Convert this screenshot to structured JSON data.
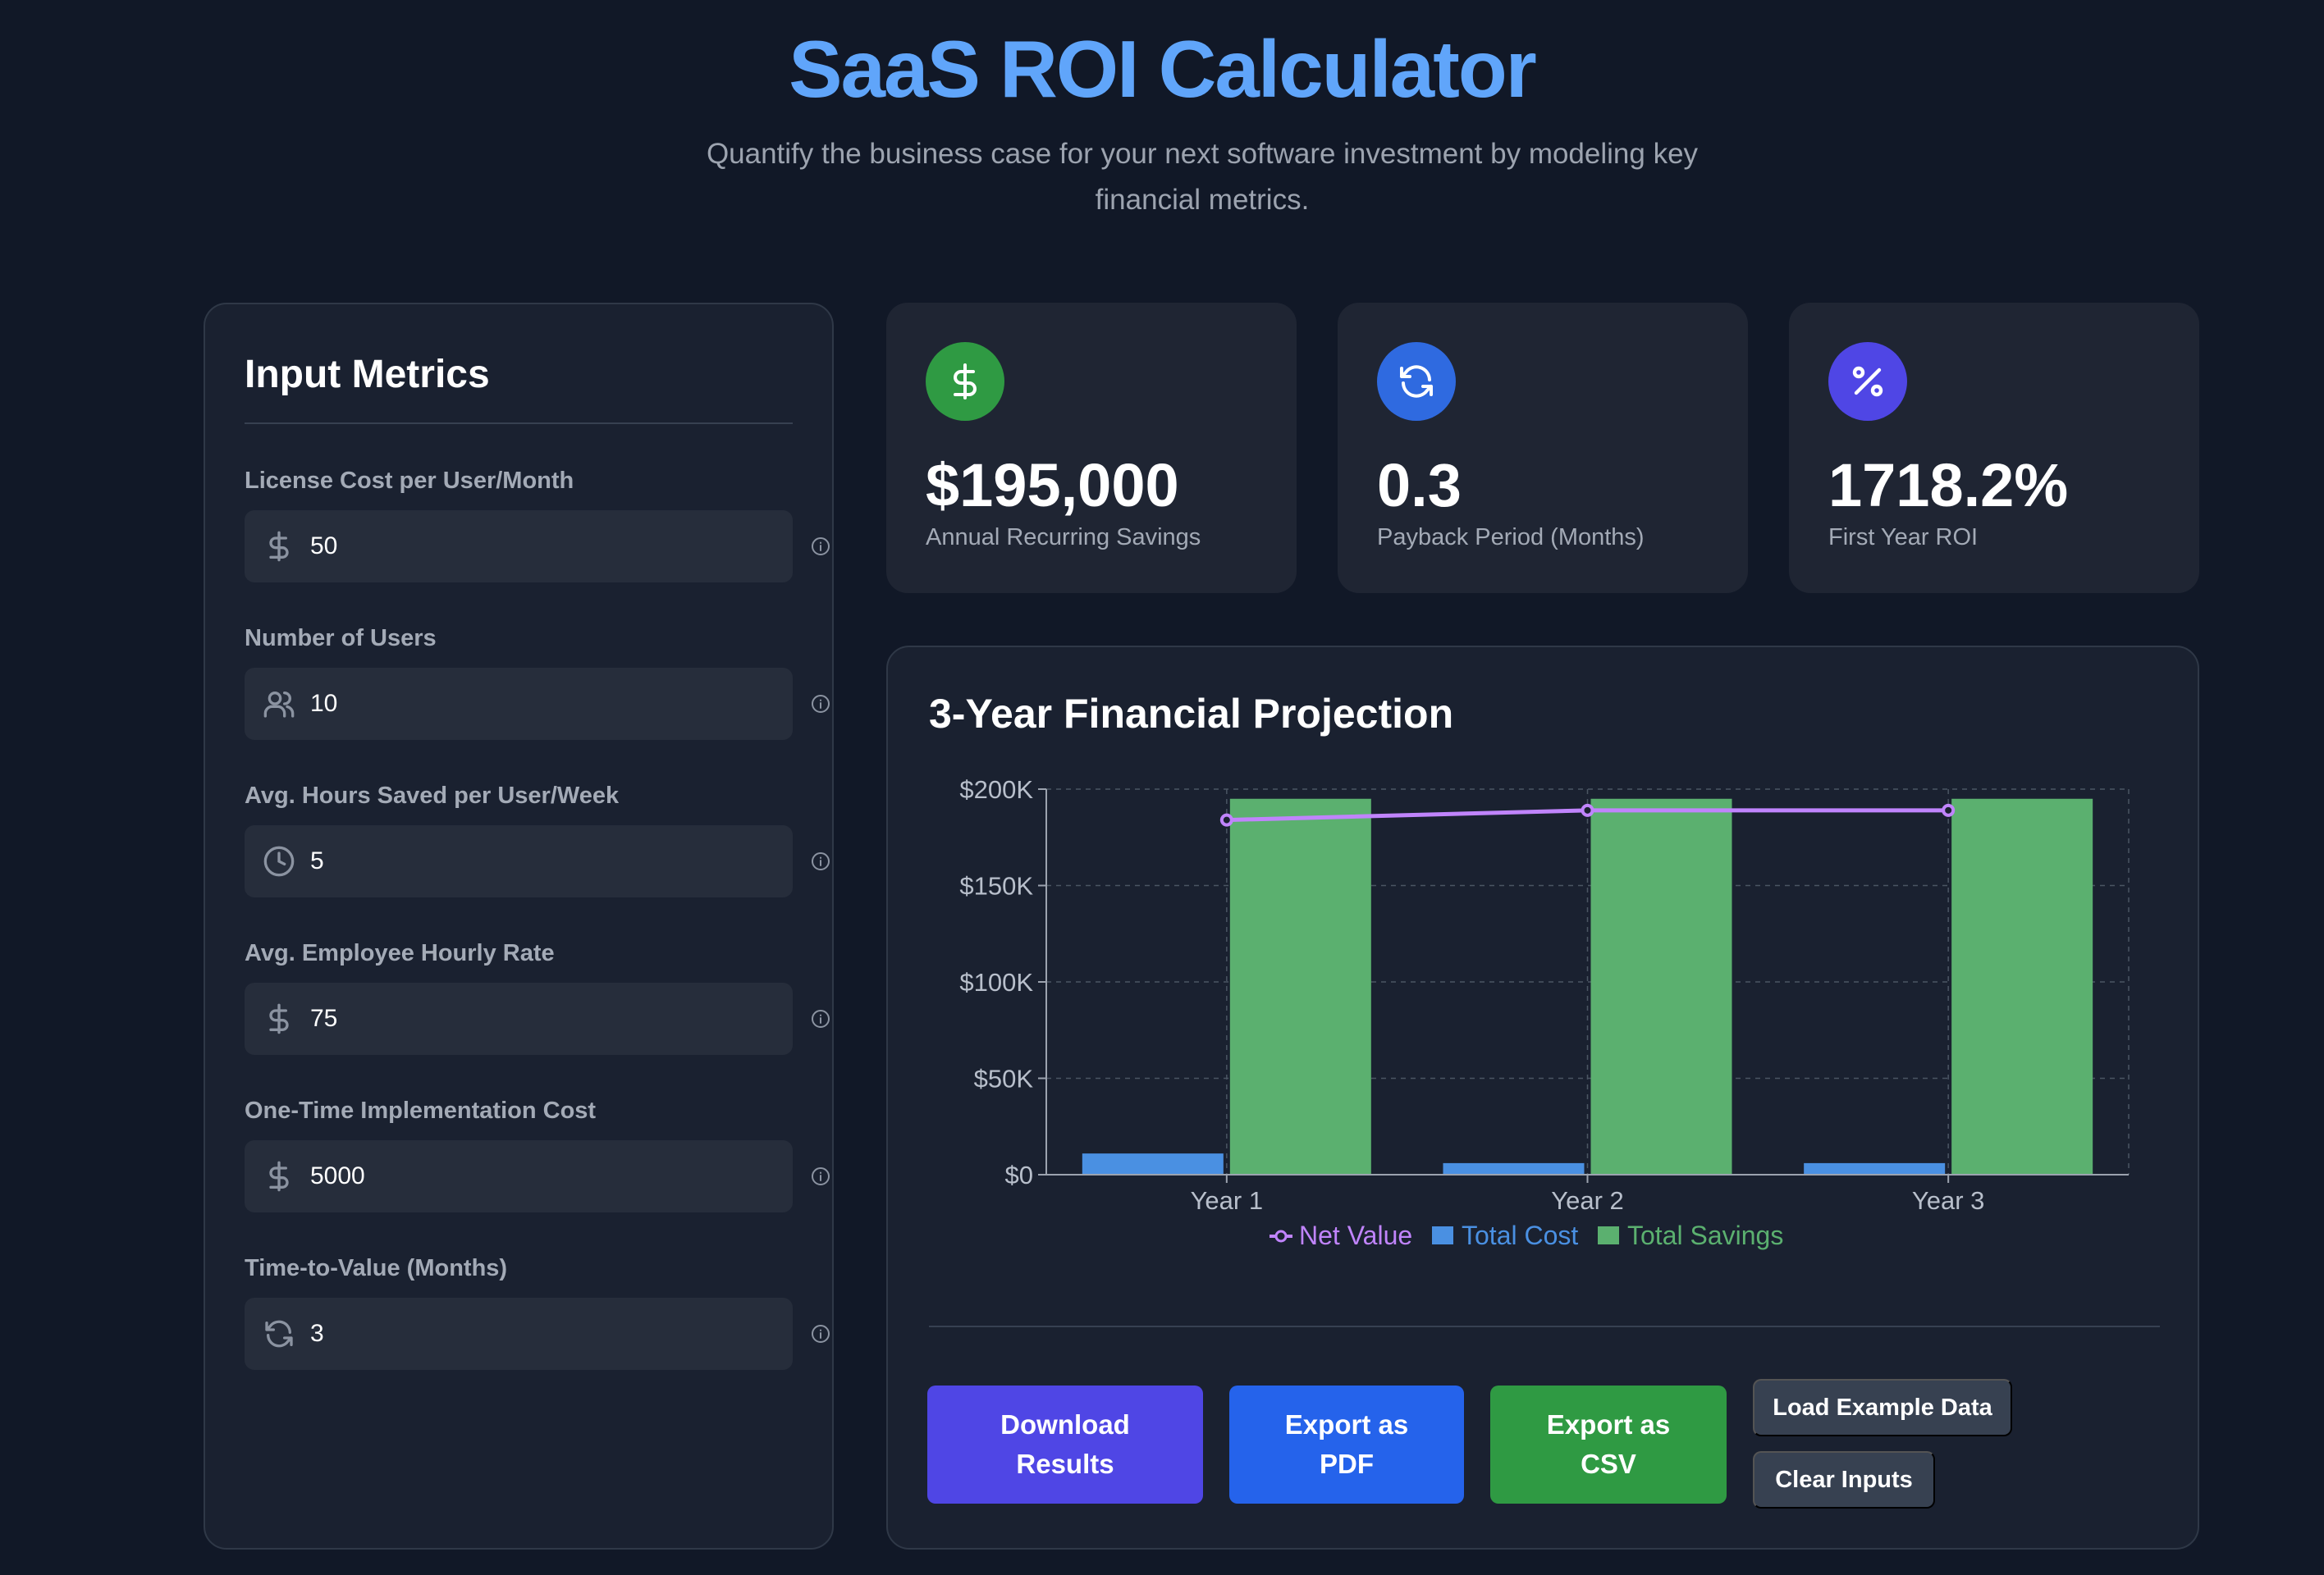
{
  "header": {
    "title": "SaaS ROI Calculator",
    "subtitle": "Quantify the business case for your next software investment by modeling key financial metrics."
  },
  "inputs": {
    "heading": "Input Metrics",
    "fields": [
      {
        "label": "License Cost per User/Month",
        "value": "50",
        "icon": "dollar-icon"
      },
      {
        "label": "Number of Users",
        "value": "10",
        "icon": "users-icon"
      },
      {
        "label": "Avg. Hours Saved per User/Week",
        "value": "5",
        "icon": "clock-icon"
      },
      {
        "label": "Avg. Employee Hourly Rate",
        "value": "75",
        "icon": "dollar-icon"
      },
      {
        "label": "One-Time Implementation Cost",
        "value": "5000",
        "icon": "dollar-icon"
      },
      {
        "label": "Time-to-Value (Months)",
        "value": "3",
        "icon": "refresh-icon"
      }
    ]
  },
  "stats": [
    {
      "value": "$195,000",
      "label": "Annual Recurring Savings",
      "icon": "dollar-icon",
      "color": "#2f9a43"
    },
    {
      "value": "0.3",
      "label": "Payback Period (Months)",
      "icon": "refresh-icon",
      "color": "#2563eb"
    },
    {
      "value": "1718.2%",
      "label": "First Year ROI",
      "icon": "percent-icon",
      "color": "#4f46e5"
    }
  ],
  "chart": {
    "heading": "3-Year Financial Projection"
  },
  "chart_data": {
    "type": "bar",
    "categories": [
      "Year 1",
      "Year 2",
      "Year 3"
    ],
    "series": [
      {
        "name": "Total Cost",
        "type": "bar",
        "color": "#4a90e2",
        "values": [
          11000,
          6000,
          6000
        ]
      },
      {
        "name": "Total Savings",
        "type": "bar",
        "color": "#5bb06f",
        "values": [
          195000,
          195000,
          195000
        ]
      },
      {
        "name": "Net Value",
        "type": "line",
        "color": "#c084fc",
        "values": [
          184000,
          189000,
          189000
        ]
      }
    ],
    "yticks": [
      "$0",
      "$50K",
      "$100K",
      "$150K",
      "$200K"
    ],
    "ylim": [
      0,
      200000
    ],
    "grid": true,
    "legend": "bottom"
  },
  "actions": {
    "download": "Download Results",
    "pdf": "Export as PDF",
    "csv": "Export as CSV",
    "example": "Load Example Data",
    "clear": "Clear Inputs"
  }
}
